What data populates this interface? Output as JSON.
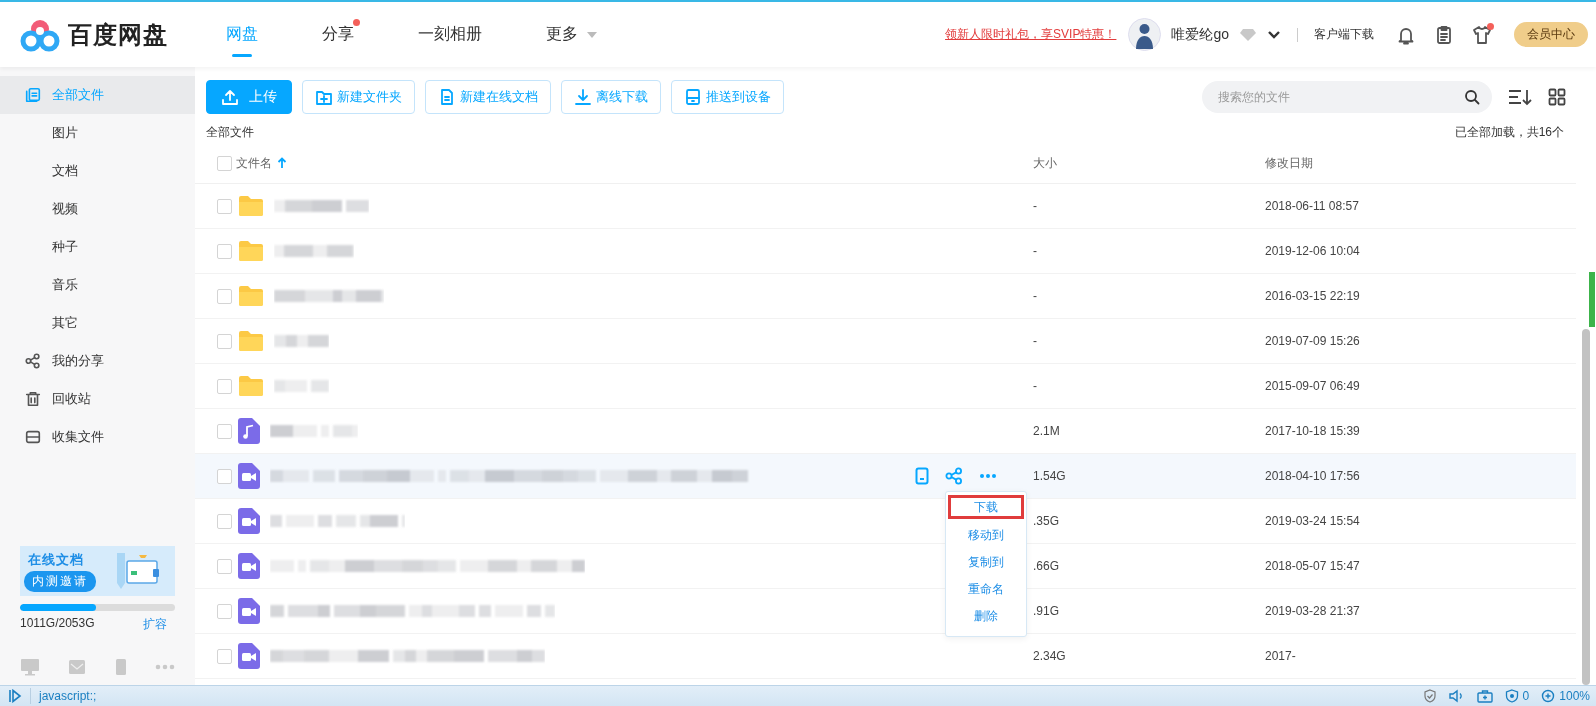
{
  "header": {
    "logo_text": "百度网盘",
    "nav": [
      {
        "label": "网盘",
        "selected": true,
        "dot": false,
        "kind": "tab"
      },
      {
        "label": "分享",
        "selected": false,
        "dot": true,
        "kind": "tab"
      },
      {
        "label": "一刻相册",
        "selected": false,
        "dot": false,
        "kind": "tab"
      },
      {
        "label": "更多",
        "selected": false,
        "dot": false,
        "kind": "dropdown"
      }
    ],
    "promo_link": "领新人限时礼包，享SVIP特惠！",
    "user": {
      "name": "唯爱纶go"
    },
    "client_download": "客户端下载",
    "icons": [
      {
        "kind": "bell",
        "dot": false
      },
      {
        "kind": "clipboard",
        "dot": false
      },
      {
        "kind": "shirt",
        "dot": true
      }
    ],
    "vip_button": "会员中心"
  },
  "sidebar": {
    "items": [
      {
        "label": "全部文件",
        "selected": true,
        "children": [
          {
            "label": "图片",
            "selected": false
          },
          {
            "label": "文档",
            "selected": false
          },
          {
            "label": "视频",
            "selected": false
          },
          {
            "label": "种子",
            "selected": false
          },
          {
            "label": "音乐",
            "selected": false
          },
          {
            "label": "其它",
            "selected": false
          }
        ]
      },
      {
        "label": "我的分享",
        "selected": false
      },
      {
        "label": "回收站",
        "selected": false
      },
      {
        "label": "收集文件",
        "selected": false
      }
    ],
    "promo": {
      "title": "在线文档",
      "button": "内测邀请"
    },
    "storage": {
      "text": "1011G/2053G",
      "level": 0.49,
      "link": "扩容"
    }
  },
  "toolbar": {
    "buttons": [
      {
        "label": "上传",
        "kind": "primary"
      },
      {
        "label": "新建文件夹",
        "kind": "outline"
      },
      {
        "label": "新建在线文档",
        "kind": "outline"
      },
      {
        "label": "离线下载",
        "kind": "outline"
      },
      {
        "label": "推送到设备",
        "kind": "outline"
      }
    ],
    "search": {
      "placeholder": "搜索您的文件"
    }
  },
  "breadcrumb": "全部文件",
  "load_status": "已全部加载，共16个",
  "table": {
    "select_all": {
      "checked": false
    },
    "columns": [
      {
        "label": "文件名",
        "sorted": true
      },
      {
        "label": "大小",
        "sorted": false
      },
      {
        "label": "修改日期",
        "sorted": false
      }
    ],
    "rows": [
      {
        "kind": "folder",
        "size": "-",
        "date": "2018-06-11 08:57",
        "checked": false,
        "hovered": false
      },
      {
        "kind": "folder",
        "size": "-",
        "date": "2019-12-06 10:04",
        "checked": false,
        "hovered": false
      },
      {
        "kind": "folder",
        "size": "-",
        "date": "2016-03-15 22:19",
        "checked": false,
        "hovered": false
      },
      {
        "kind": "folder",
        "size": "-",
        "date": "2019-07-09 15:26",
        "checked": false,
        "hovered": false
      },
      {
        "kind": "folder",
        "size": "-",
        "date": "2015-09-07 06:49",
        "checked": false,
        "hovered": false
      },
      {
        "kind": "audio",
        "size": "2.1M",
        "date": "2017-10-18 15:39",
        "checked": false,
        "hovered": false
      },
      {
        "kind": "video",
        "size": "1.54G",
        "date": "2018-04-10 17:56",
        "checked": false,
        "hovered": true
      },
      {
        "kind": "video",
        "size": ".35G",
        "date": "2019-03-24 15:54",
        "checked": false,
        "hovered": false
      },
      {
        "kind": "video",
        "size": ".66G",
        "date": "2018-05-07 15:47",
        "checked": false,
        "hovered": false
      },
      {
        "kind": "video",
        "size": ".91G",
        "date": "2019-03-28 21:37",
        "checked": false,
        "hovered": false
      },
      {
        "kind": "video",
        "size": "2.34G",
        "date": "2017-",
        "checked": false,
        "hovered": false
      }
    ]
  },
  "context_menu": {
    "items": [
      {
        "label": "下载",
        "highlighted": true
      },
      {
        "label": "移动到",
        "highlighted": false
      },
      {
        "label": "复制到",
        "highlighted": false
      },
      {
        "label": "重命名",
        "highlighted": false
      },
      {
        "label": "删除",
        "highlighted": false
      }
    ]
  },
  "status_bar": {
    "url": "javascript:;",
    "ad_count": "0",
    "zoom": "100%"
  }
}
